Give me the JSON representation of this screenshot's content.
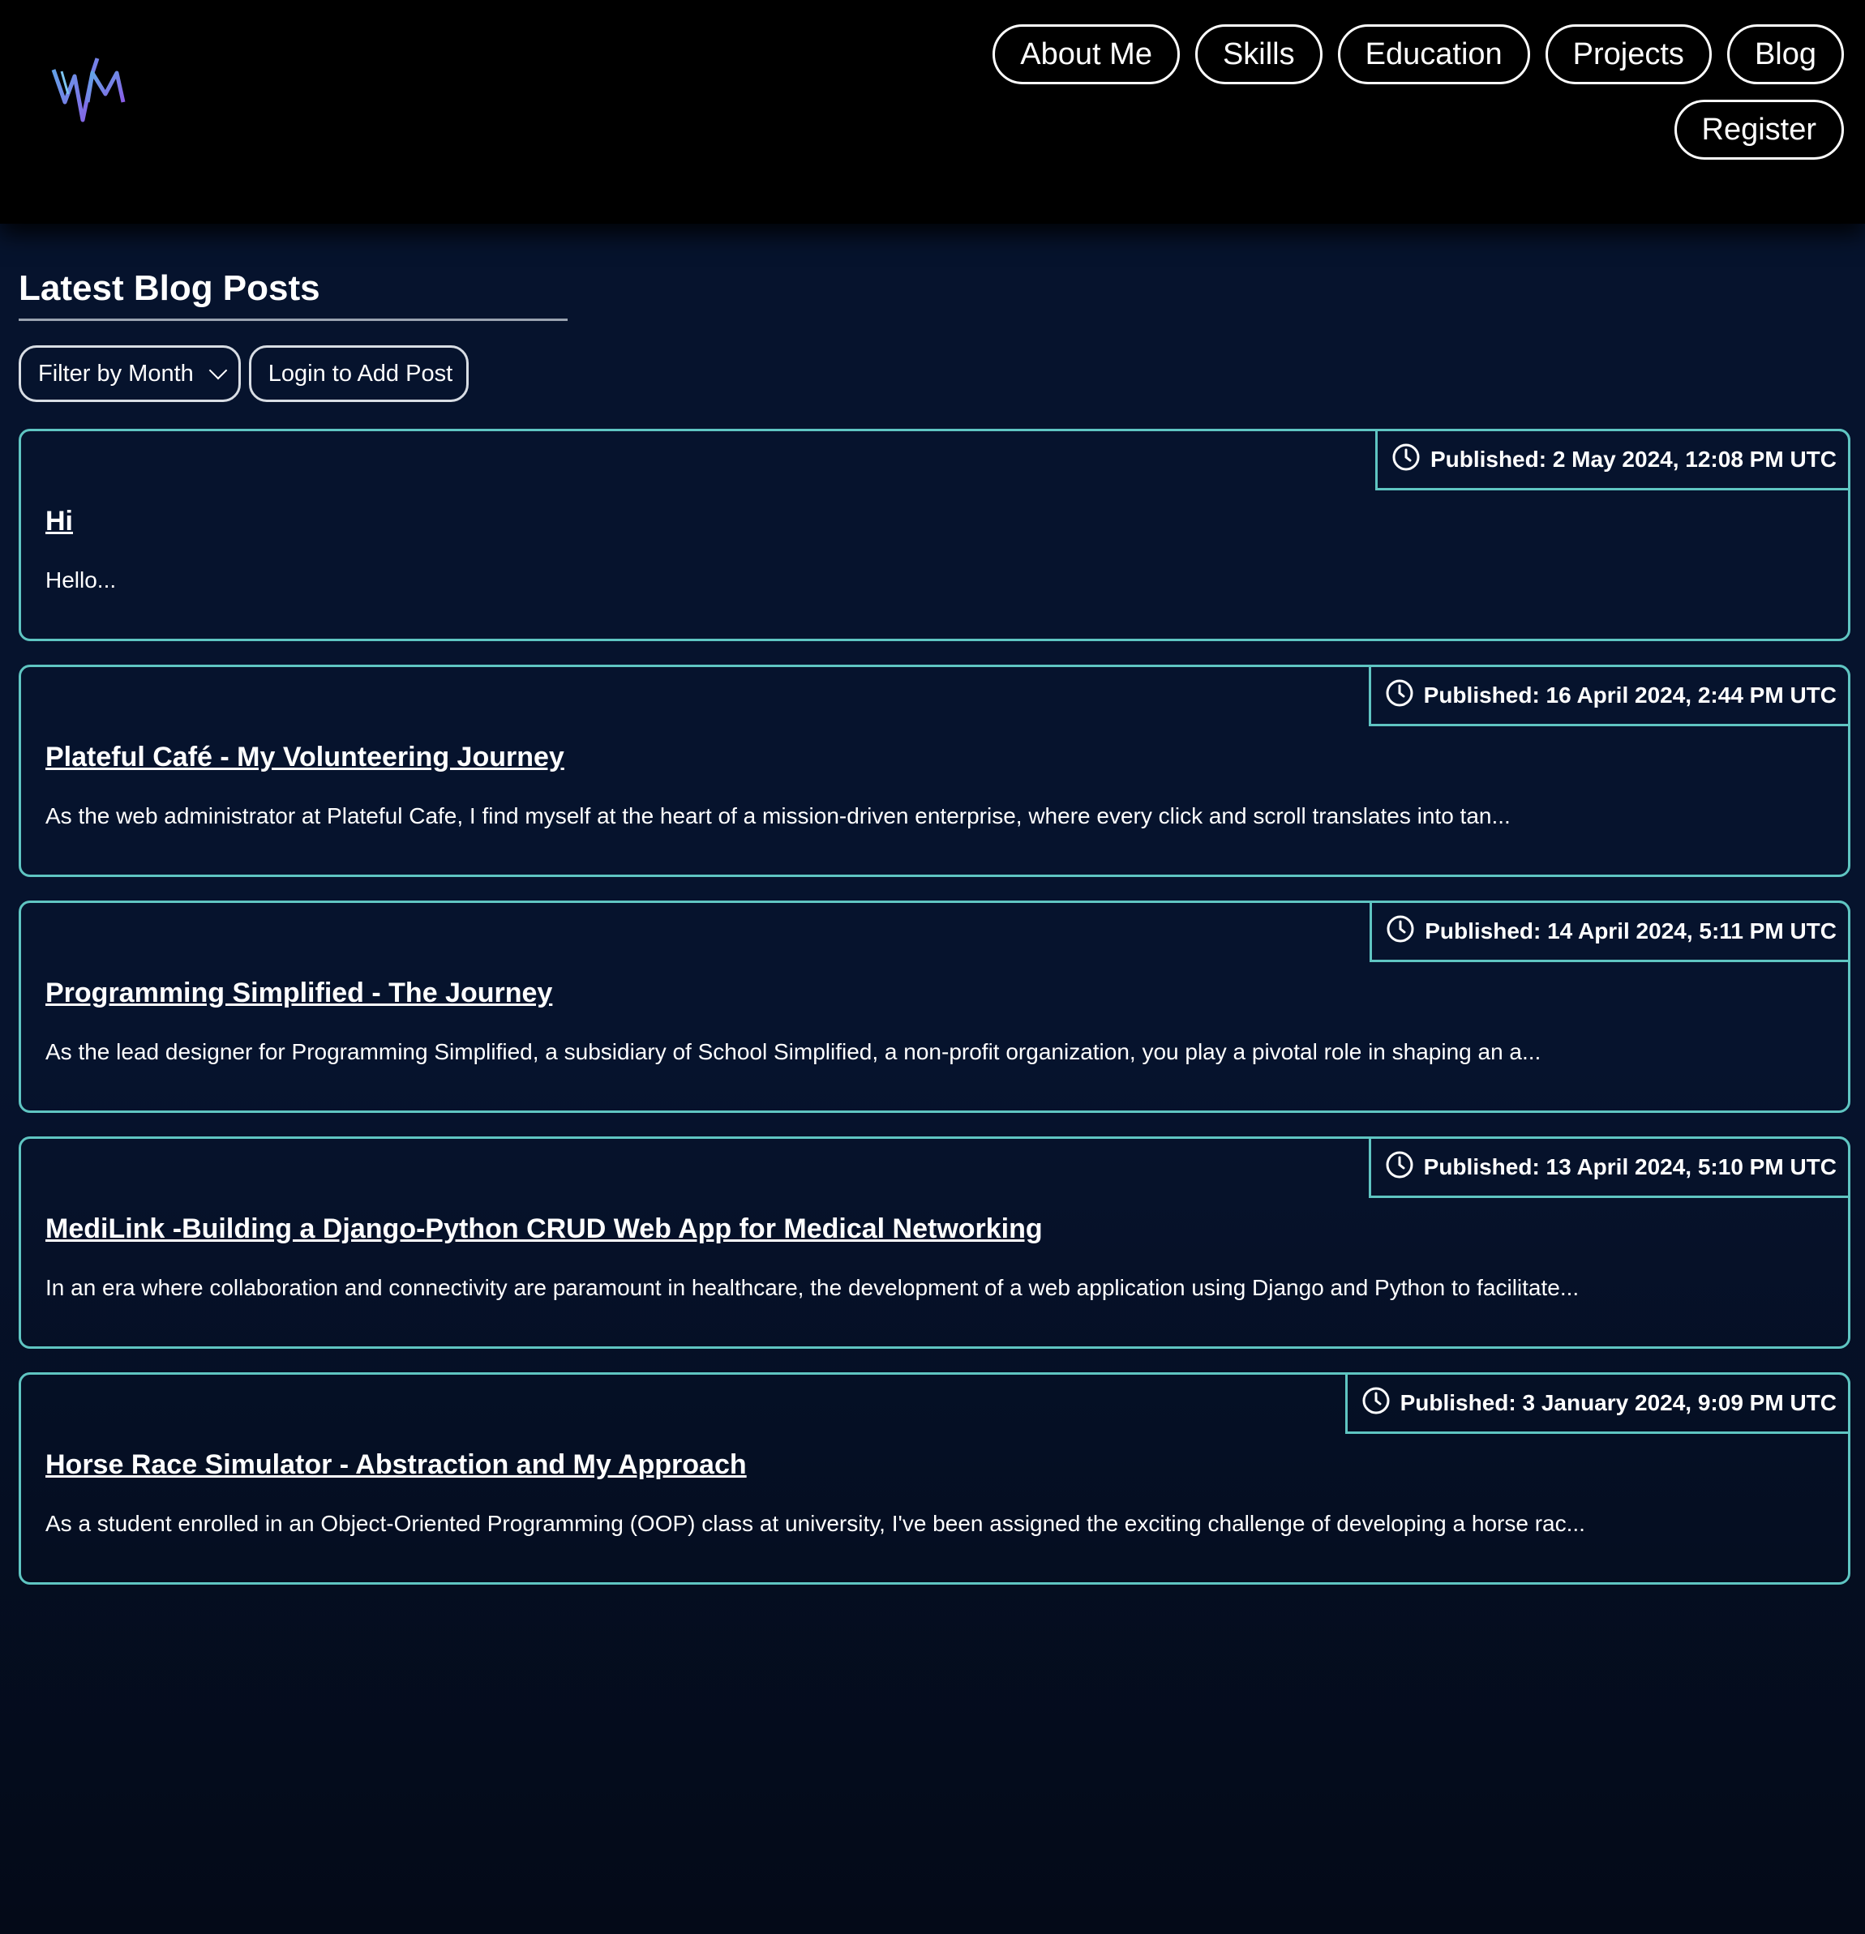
{
  "nav": {
    "items": [
      {
        "label": "About Me"
      },
      {
        "label": "Skills"
      },
      {
        "label": "Education"
      },
      {
        "label": "Projects"
      },
      {
        "label": "Blog"
      },
      {
        "label": "Register"
      }
    ]
  },
  "main": {
    "title": "Latest Blog Posts",
    "filter_label": "Filter by Month",
    "login_label": "Login to Add Post"
  },
  "posts": [
    {
      "published": "Published: 2 May 2024, 12:08 PM UTC",
      "title": "Hi",
      "excerpt": "Hello..."
    },
    {
      "published": "Published: 16 April 2024, 2:44 PM UTC",
      "title": "Plateful Café - My Volunteering Journey",
      "excerpt": "As the web administrator at Plateful Cafe, I find myself at the heart of a mission-driven enterprise, where every click and scroll translates into tan..."
    },
    {
      "published": "Published: 14 April 2024, 5:11 PM UTC",
      "title": "Programming Simplified - The Journey",
      "excerpt": "As the lead designer for Programming Simplified, a subsidiary of School Simplified, a non-profit organization, you play a pivotal role in shaping an a..."
    },
    {
      "published": "Published: 13 April 2024, 5:10 PM UTC",
      "title": "MediLink -Building a Django-Python CRUD Web App for Medical Networking",
      "excerpt": "In an era where collaboration and connectivity are paramount in healthcare, the development of a web application using Django and Python to facilitate..."
    },
    {
      "published": "Published: 3 January 2024, 9:09 PM UTC",
      "title": "Horse Race Simulator - Abstraction and My Approach",
      "excerpt": "As a student enrolled in an Object-Oriented Programming (OOP) class at university, I've been assigned the exciting challenge of developing a horse rac..."
    }
  ],
  "colors": {
    "background": "#06132d",
    "header": "#000000",
    "card_border": "#5fc5c2",
    "logo_gradient_start": "#5fa8e6",
    "logo_gradient_end": "#8a5ce6"
  },
  "icons": {
    "logo": "vm-logo",
    "clock": "clock-icon",
    "dropdown": "chevron-down-icon"
  }
}
